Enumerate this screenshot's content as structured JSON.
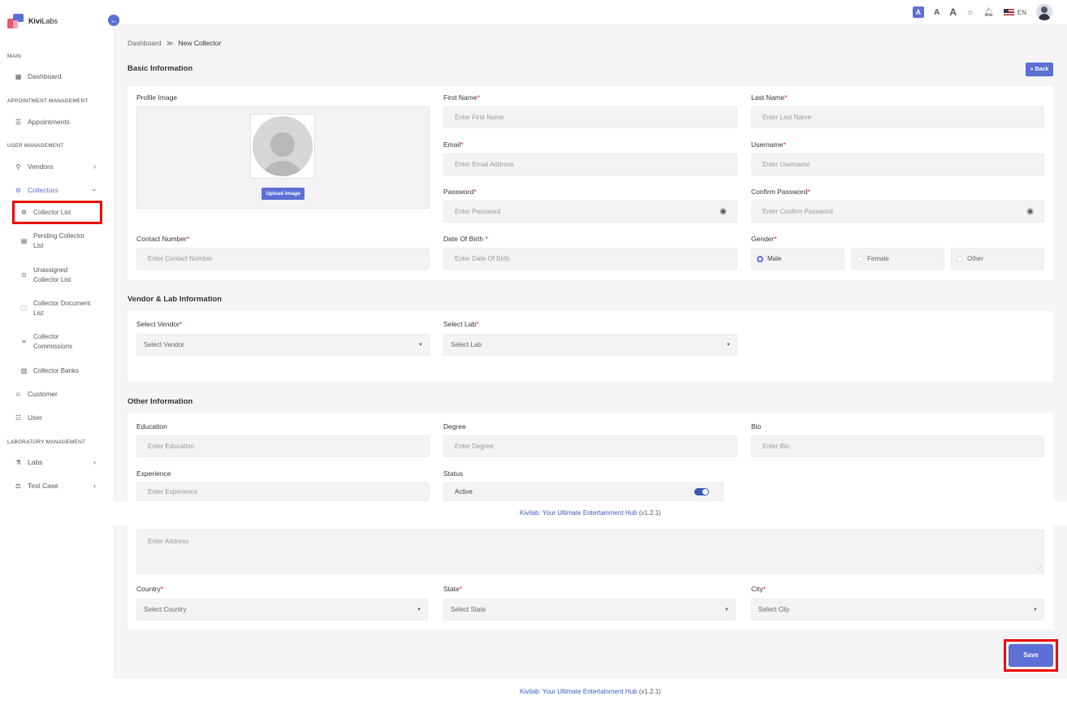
{
  "brand": {
    "name_bold": "Kivi",
    "name_rest": "Labs"
  },
  "sidebar": {
    "sections": {
      "main": "MAIN",
      "appointment": "APPOINTMENT MANAGEMENT",
      "user": "USER MANAGEMENT",
      "lab": "LABORATORY MANAGEMENT"
    },
    "items": {
      "dashboard": "Dashboard",
      "appointments": "Appointments",
      "vendors": "Vendors",
      "collectors": "Collectors",
      "customer": "Customer",
      "user": "User",
      "labs": "Labs",
      "test_case": "Test Case"
    },
    "sub_items": {
      "collector_list": "Collector List",
      "pending_l1": "Pending Collector",
      "pending_l2": "List",
      "unassigned_l1": "Unassigned",
      "unassigned_l2": "Collector List",
      "document_l1": "Collector Document",
      "document_l2": "List",
      "commissions_l1": "Collector",
      "commissions_l2": "Commissions",
      "banks": "Collector Banks"
    }
  },
  "header": {
    "font_small": "A",
    "font_mid": "A",
    "font_large": "A",
    "lang": "EN"
  },
  "breadcrumb": {
    "home": "Dashboard",
    "sep": "≫",
    "current": "New Collector"
  },
  "basic": {
    "title": "Basic Information",
    "back": "« Back",
    "profile_label": "Profile Image",
    "upload": "Upload Image",
    "first_name": {
      "label": "First Name",
      "placeholder": "Enter First Name"
    },
    "last_name": {
      "label": "Last Name",
      "placeholder": "Enter Last Name"
    },
    "email": {
      "label": "Email",
      "placeholder": "Enter Email Address"
    },
    "username": {
      "label": "Username",
      "placeholder": "Enter Username"
    },
    "password": {
      "label": "Password",
      "placeholder": "Enter Password"
    },
    "confirm_password": {
      "label": "Confirm Password",
      "placeholder": "Enter Confirm Password"
    },
    "contact": {
      "label": "Contact Number",
      "placeholder": "Enter Contact Number"
    },
    "dob": {
      "label": "Date Of Birth ",
      "placeholder": "Enter Date Of Birth"
    },
    "gender": {
      "label": "Gender",
      "options": [
        "Male",
        "Female",
        "Other"
      ],
      "selected": "Male"
    }
  },
  "vendor_lab": {
    "title": "Vendor & Lab Information",
    "vendor": {
      "label": "Select Vendor",
      "value": "Select Vendor"
    },
    "lab": {
      "label": "Select Lab",
      "value": "Select Lab"
    }
  },
  "other": {
    "title": "Other Information",
    "education": {
      "label": "Education",
      "placeholder": "Enter Education"
    },
    "degree": {
      "label": "Degree",
      "placeholder": "Enter Degree"
    },
    "bio": {
      "label": "Bio",
      "placeholder": "Enter Bio"
    },
    "experience": {
      "label": "Experience",
      "placeholder": "Enter Experience"
    },
    "status": {
      "label": "Status",
      "value": "Active",
      "enabled": true
    },
    "address": {
      "placeholder": "Enter Address"
    },
    "country": {
      "label": "Country",
      "value": "Select Country"
    },
    "state": {
      "label": "State",
      "value": "Select State"
    },
    "city": {
      "label": "City",
      "value": "Select City"
    }
  },
  "save": "Save",
  "footer": {
    "text": "Kivilab: Your Ultimate Entertainment Hub",
    "version": "(v1.2.1)"
  },
  "req_mark": "*",
  "colors": {
    "accent": "#5b6fd6",
    "required": "#e02020",
    "highlight": "#ee0000"
  }
}
